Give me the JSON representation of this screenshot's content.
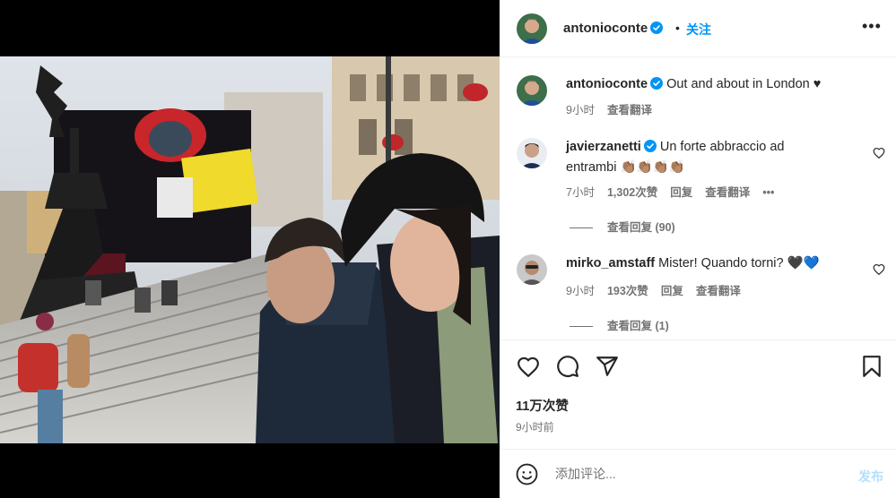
{
  "post": {
    "username": "antonioconte",
    "follow_label": "关注",
    "caption": "Out and about in London ♥",
    "caption_time": "9小时",
    "caption_translate": "查看翻译",
    "likes": "11万次赞",
    "time_ago": "9小时前"
  },
  "comments": [
    {
      "username": "javierzanetti",
      "text": "Un forte abbraccio ad entrambi 👏🏽👏🏽👏🏽👏🏽",
      "time": "7小时",
      "likes": "1,302次赞",
      "reply": "回复",
      "translate": "查看翻译",
      "view_replies": "查看回复 (90)"
    },
    {
      "username": "mirko_amstaff",
      "text": "Mister! Quando torni? 🖤💙",
      "time": "9小时",
      "likes": "193次赞",
      "reply": "回复",
      "translate": "查看翻译",
      "view_replies": "查看回复 (1)"
    }
  ],
  "composer": {
    "placeholder": "添加评论...",
    "post_label": "发布"
  },
  "icons": {
    "verified": "verified-badge-icon",
    "more": "more-options-icon",
    "like": "heart-icon",
    "comment": "comment-icon",
    "share": "share-icon",
    "save": "bookmark-icon",
    "emoji": "emoji-icon"
  },
  "colors": {
    "accent": "#0095f6",
    "verified": "#0095f6",
    "muted": "#737373",
    "post_disabled": "#b2dffc"
  }
}
